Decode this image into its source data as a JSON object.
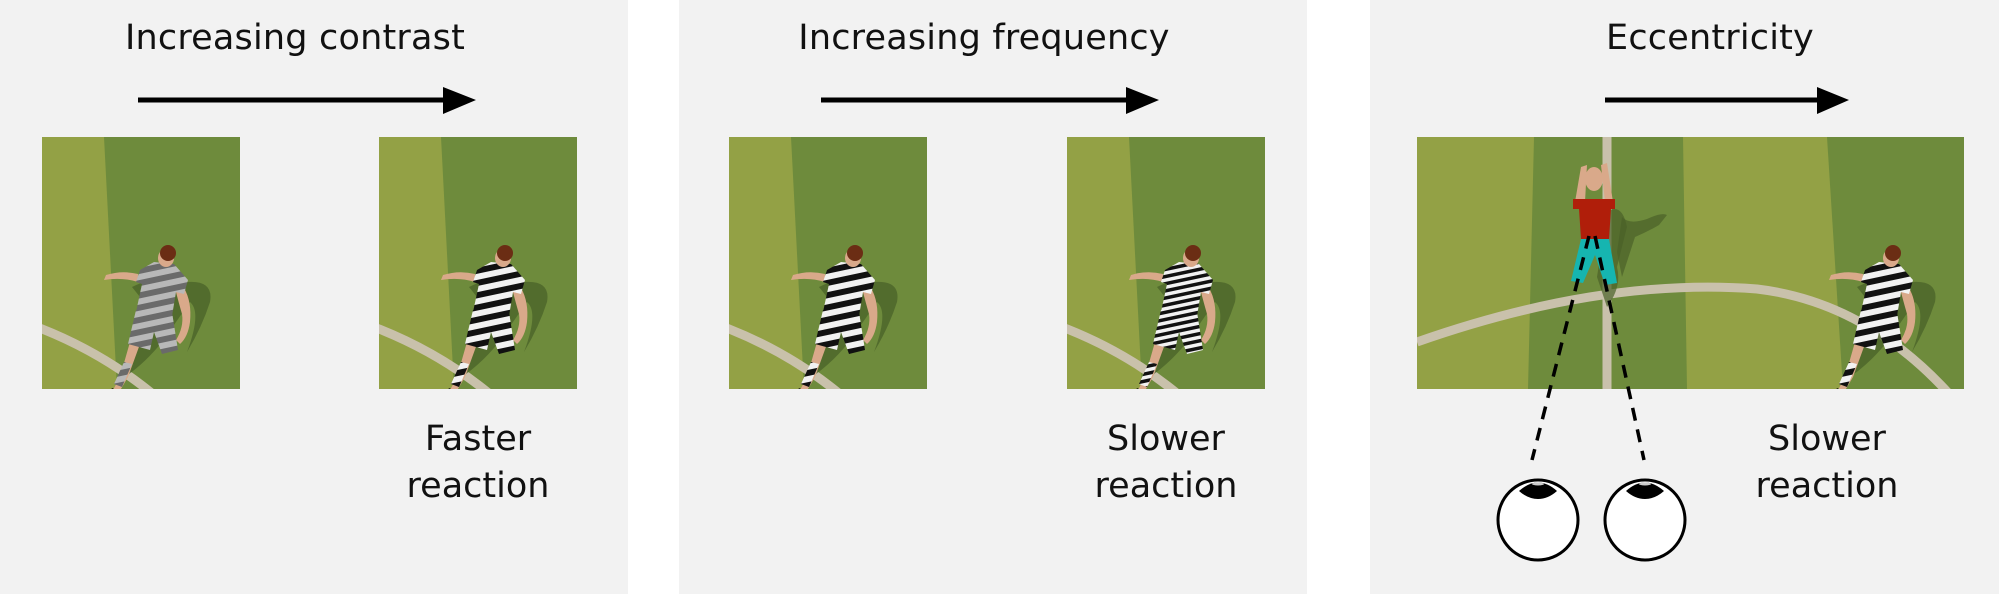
{
  "figure": {
    "panels": [
      {
        "title": "Increasing contrast",
        "arrow": "right-arrow",
        "scenes": [
          {
            "name": "low-contrast-player",
            "stripe_contrast": "low",
            "stripe_frequency": "normal"
          },
          {
            "name": "high-contrast-player",
            "stripe_contrast": "high",
            "stripe_frequency": "normal"
          }
        ],
        "caption": {
          "line1": "Faster",
          "line2": "reaction"
        }
      },
      {
        "title": "Increasing frequency",
        "arrow": "right-arrow",
        "scenes": [
          {
            "name": "low-frequency-player",
            "stripe_contrast": "high",
            "stripe_frequency": "normal"
          },
          {
            "name": "high-frequency-player",
            "stripe_contrast": "high",
            "stripe_frequency": "high"
          }
        ],
        "caption": {
          "line1": "Slower",
          "line2": "reaction"
        }
      },
      {
        "title": "Eccentricity",
        "arrow": "right-arrow",
        "scenes": [
          {
            "name": "wide-field-scene",
            "fixated_player": "red-shirt-player",
            "peripheral_player": "striped-player"
          }
        ],
        "caption": {
          "line1": "Slower",
          "line2": "reaction"
        },
        "observer": {
          "icon": "eyes-icon",
          "count": 2,
          "gaze": "dashed-lines-to-fixated-player"
        }
      }
    ],
    "colors": {
      "panel_bg": "#f2f2f2",
      "grass_light": "#93a145",
      "grass_dark": "#6e8b3c",
      "field_line": "#c9c1ab",
      "shadow": "#4a6128",
      "red_shirt": "#b01e0a",
      "teal_shorts": "#16b5b0",
      "skin": "#d9a98a",
      "hair": "#6b2d14",
      "ink": "#000000"
    }
  }
}
